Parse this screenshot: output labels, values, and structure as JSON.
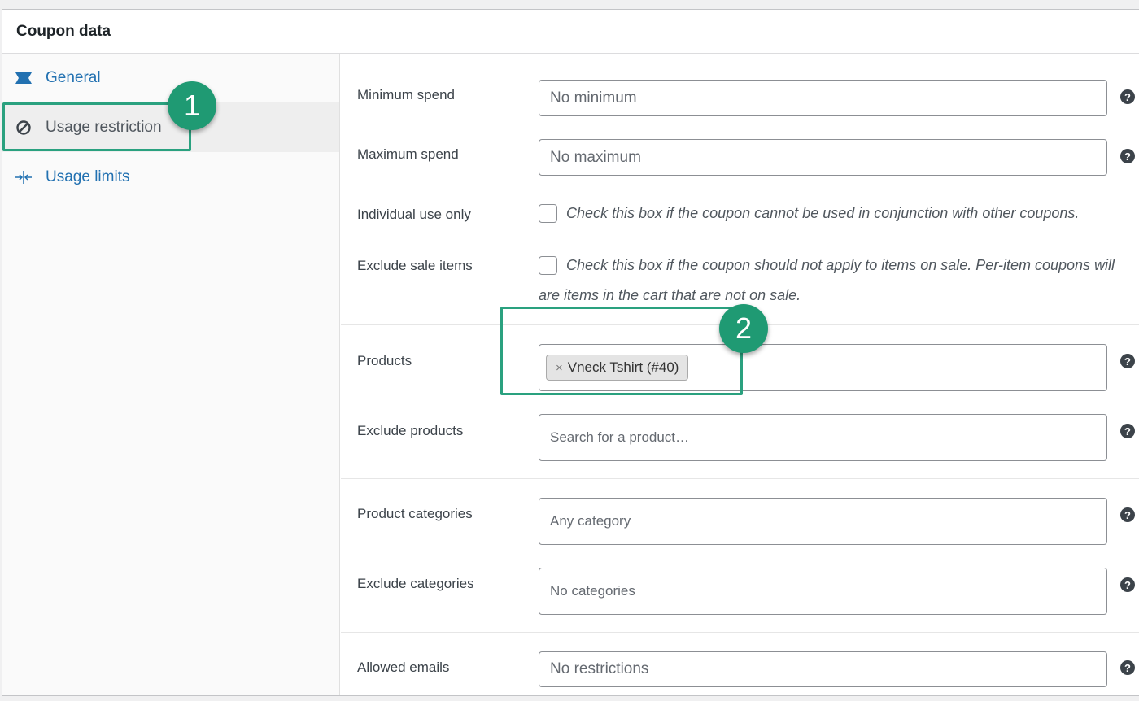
{
  "panel": {
    "title": "Coupon data"
  },
  "tabs": [
    {
      "label": "General",
      "icon": "ticket-icon"
    },
    {
      "label": "Usage restriction",
      "icon": "no-entry-icon",
      "active": true
    },
    {
      "label": "Usage limits",
      "icon": "arrows-inward-icon"
    }
  ],
  "fields": {
    "minimum_spend": {
      "label": "Minimum spend",
      "placeholder": "No minimum"
    },
    "maximum_spend": {
      "label": "Maximum spend",
      "placeholder": "No maximum"
    },
    "individual_use": {
      "label": "Individual use only",
      "description": "Check this box if the coupon cannot be used in conjunction with other coupons."
    },
    "exclude_sale": {
      "label": "Exclude sale items",
      "description_line1": "Check this box if the coupon should not apply to items on sale. Per-item coupons will",
      "description_line2": "are items in the cart that are not on sale."
    },
    "products": {
      "label": "Products",
      "chip_remove": "×",
      "chip": "Vneck Tshirt (#40)"
    },
    "exclude_products": {
      "label": "Exclude products",
      "placeholder": "Search for a product…"
    },
    "product_categories": {
      "label": "Product categories",
      "placeholder": "Any category"
    },
    "exclude_categories": {
      "label": "Exclude categories",
      "placeholder": "No categories"
    },
    "allowed_emails": {
      "label": "Allowed emails",
      "placeholder": "No restrictions"
    }
  },
  "help_glyph": "?",
  "callouts": [
    {
      "number": "1"
    },
    {
      "number": "2"
    }
  ],
  "colors": {
    "accent_link": "#2271b1",
    "callout_green": "#1f9a73"
  }
}
